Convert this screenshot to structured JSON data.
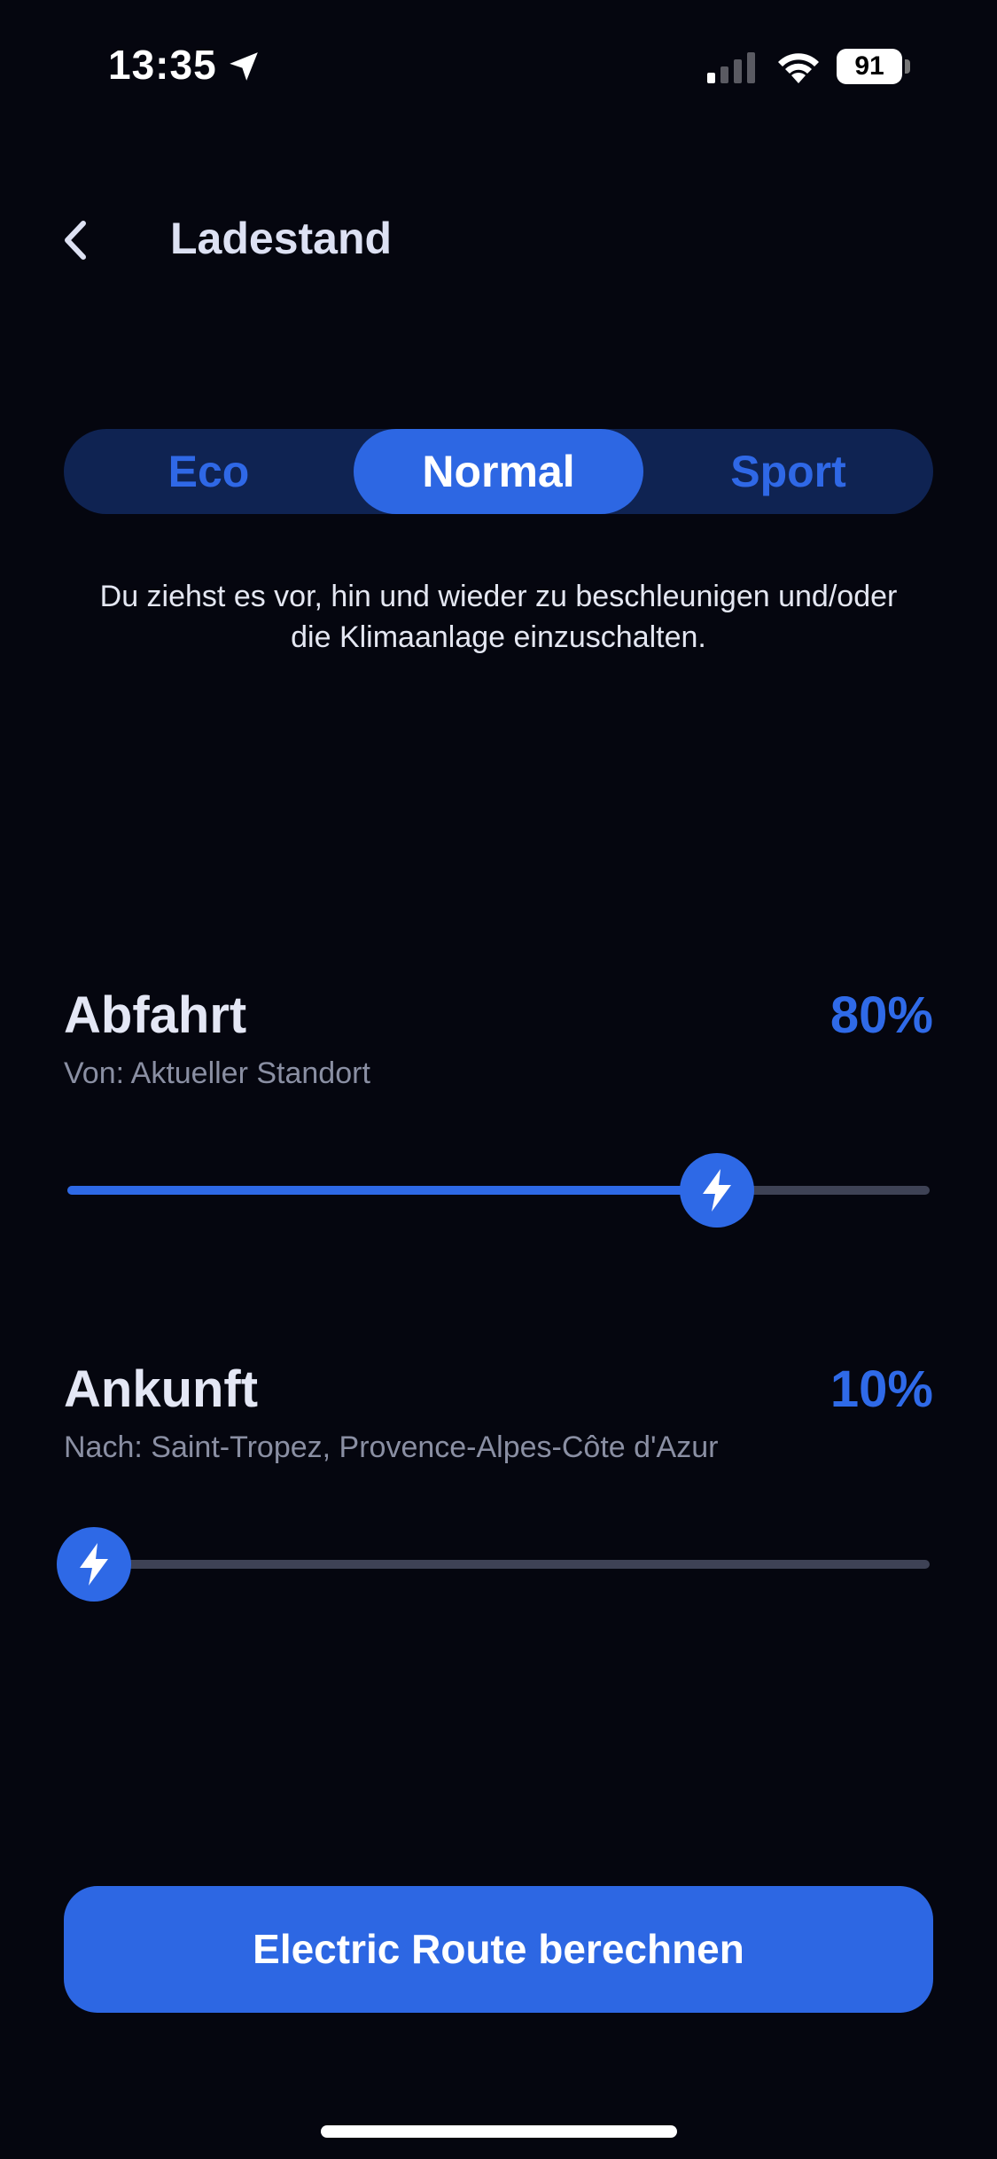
{
  "status_bar": {
    "time": "13:35",
    "battery": "91"
  },
  "header": {
    "title": "Ladestand"
  },
  "mode": {
    "options": [
      "Eco",
      "Normal",
      "Sport"
    ],
    "selected": "Normal",
    "description": "Du ziehst es vor, hin und wieder zu beschleunigen und/oder die Klimaanlage einzuschalten."
  },
  "departure": {
    "title": "Abfahrt",
    "percent_label": "80%",
    "subtitle": "Von: Aktueller Standort",
    "slider_value": 0.77
  },
  "arrival": {
    "title": "Ankunft",
    "percent_label": "10%",
    "subtitle": "Nach: Saint-Tropez, Provence-Alpes-Côte d'Azur",
    "slider_value": 0.0
  },
  "cta": {
    "label": "Electric Route berechnen"
  },
  "colors": {
    "background": "#05060f",
    "accent": "#2d67e3",
    "segment_bg": "#0f2352",
    "track": "#3e4255"
  }
}
